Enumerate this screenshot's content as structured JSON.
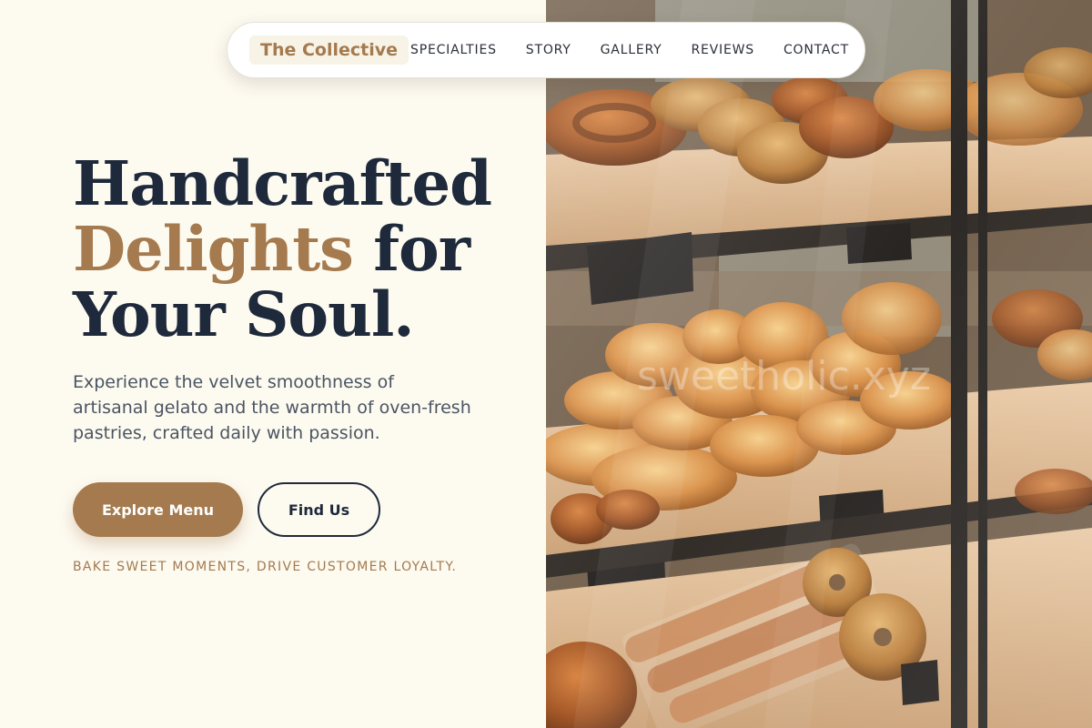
{
  "brand": {
    "name": "The Collective"
  },
  "nav": {
    "items": [
      {
        "label": "SPECIALTIES"
      },
      {
        "label": "STORY"
      },
      {
        "label": "GALLERY"
      },
      {
        "label": "REVIEWS"
      },
      {
        "label": "CONTACT"
      }
    ]
  },
  "hero": {
    "headline_line1": "Handcrafted",
    "headline_accent": "Delights",
    "headline_line2_rest": " for",
    "headline_line3": "Your Soul.",
    "subcopy": "Experience the velvet smoothness of artisanal gelato and the warmth of oven-fresh pastries, crafted daily with passion.",
    "primary_cta": "Explore Menu",
    "secondary_cta": "Find Us",
    "tagline": "BAKE SWEET MOMENTS, DRIVE CUSTOMER LOYALTY.",
    "image_watermark": "sweetholic.xyz"
  },
  "colors": {
    "background": "#fdfaf0",
    "accent": "#a47a4e",
    "heading": "#1e2a3b",
    "body_text": "#4a5563"
  },
  "icons": {
    "hero_image": "bakery-display-case-photo"
  }
}
